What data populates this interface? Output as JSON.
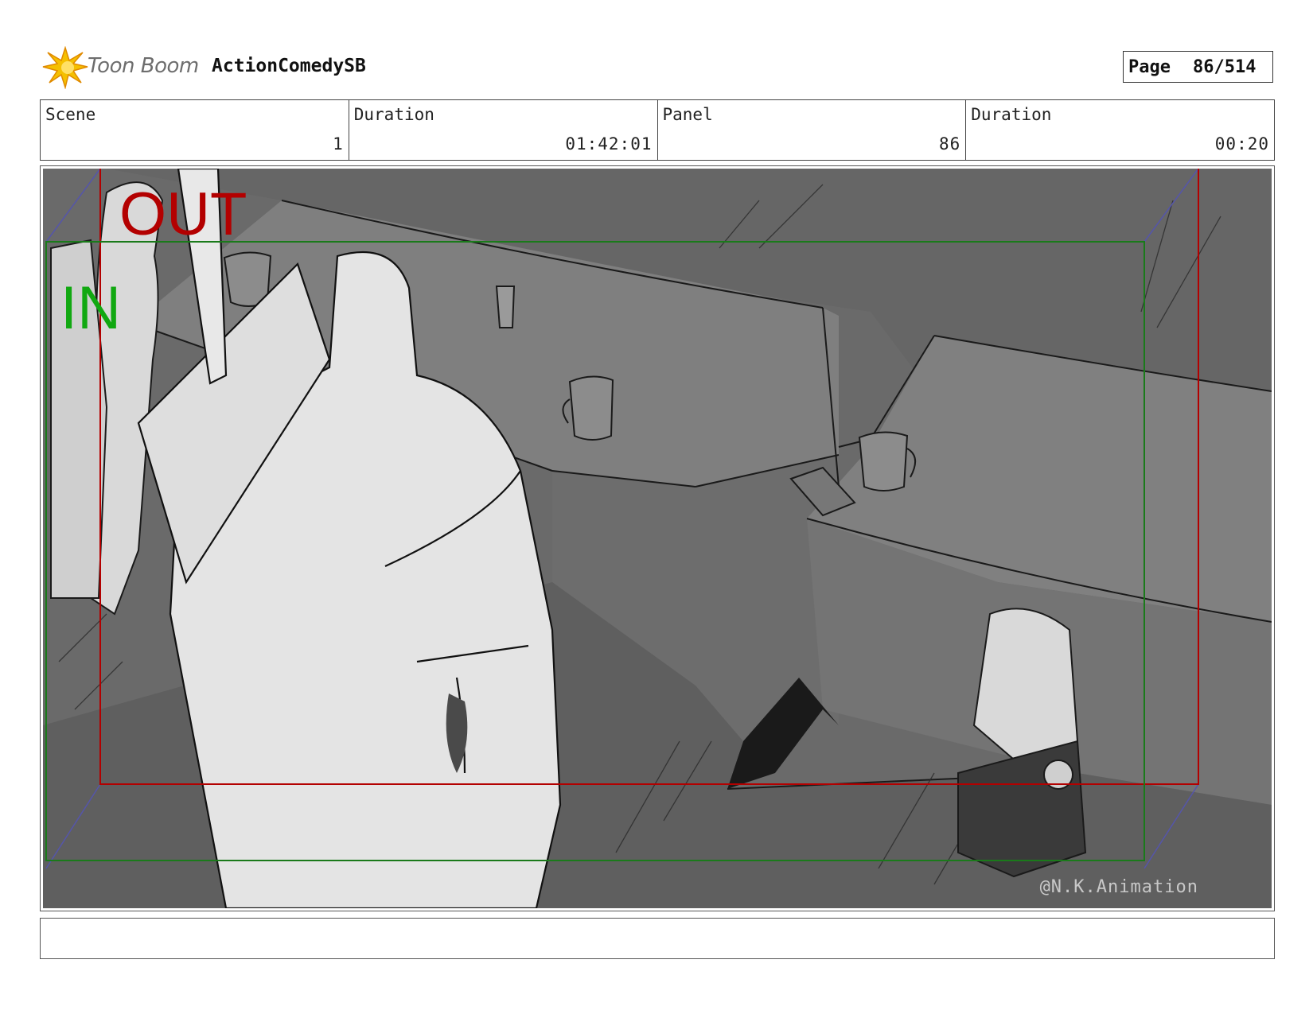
{
  "header": {
    "brand": "Toon Boom",
    "project": "ActionComedySB",
    "page_label": "Page",
    "page_value": "86/514"
  },
  "info": {
    "scene_label": "Scene",
    "scene_value": "1",
    "duration_label": "Duration",
    "duration_value": "01:42:01",
    "panel_label": "Panel",
    "panel_value": "86",
    "panel_duration_label": "Duration",
    "panel_duration_value": "00:20"
  },
  "panel": {
    "out_label": "OUT",
    "in_label": "IN",
    "watermark": "@N.K.Animation",
    "colors": {
      "out_frame": "#b30000",
      "in_frame": "#1a7a1a",
      "camera_path": "#5555aa"
    }
  },
  "notes": {
    "text": ""
  }
}
